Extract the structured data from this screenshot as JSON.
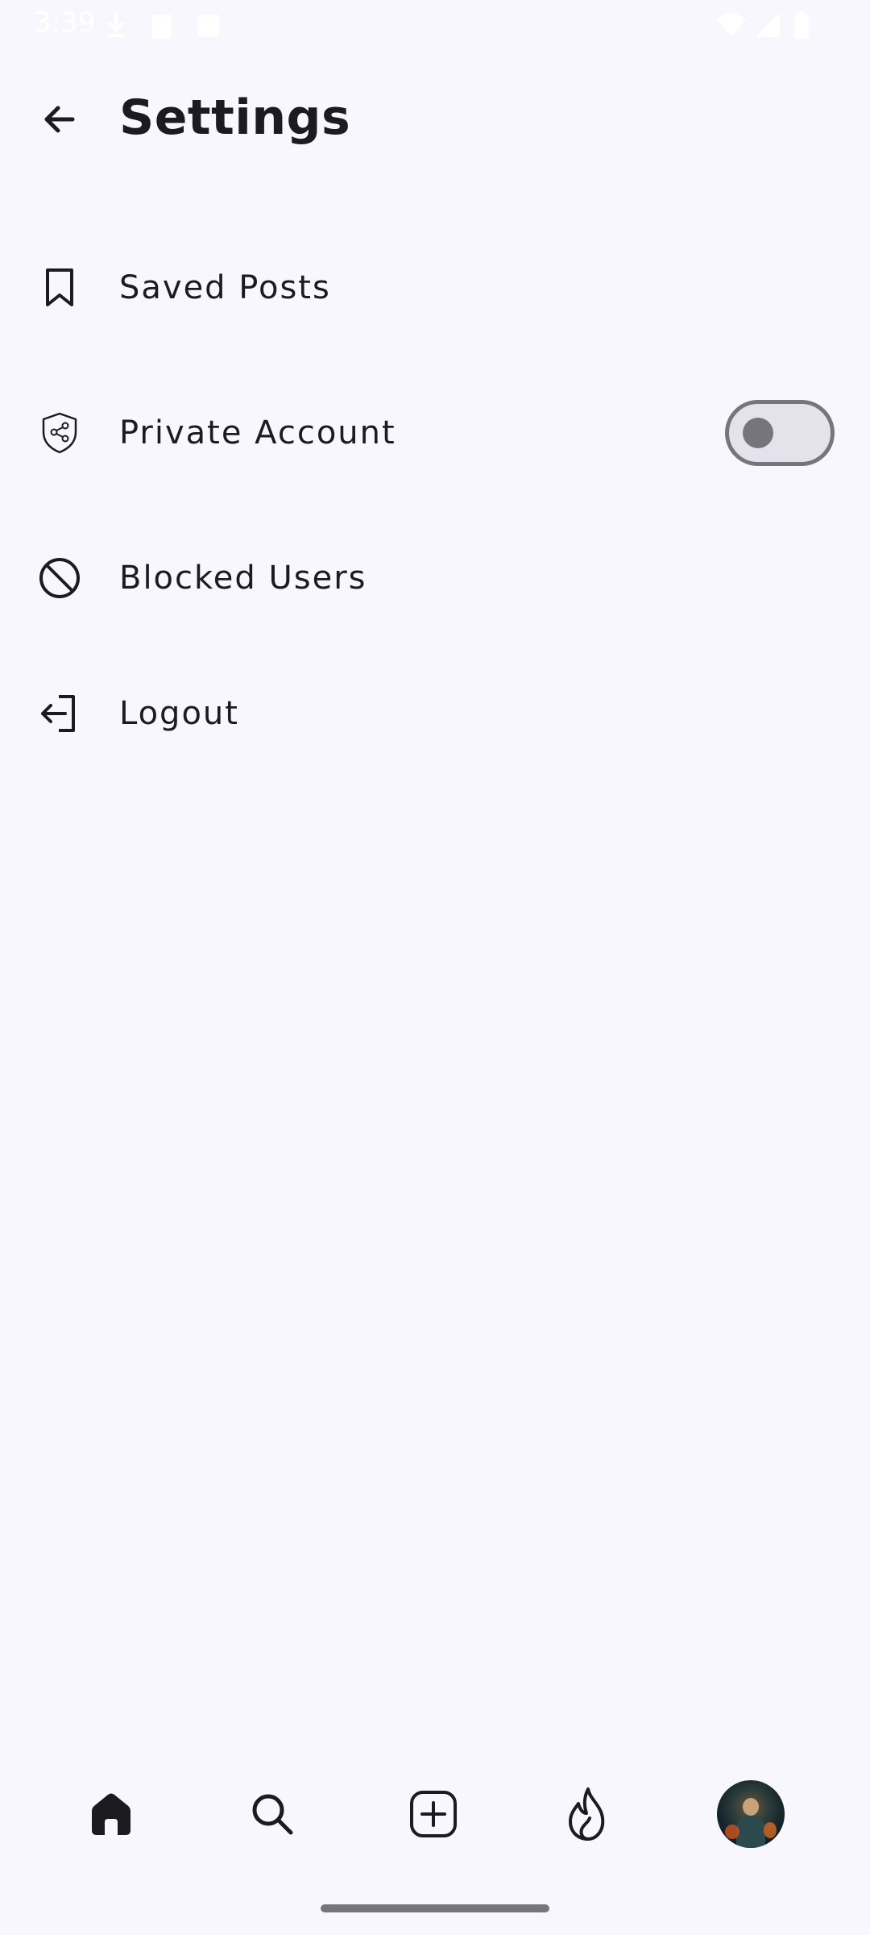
{
  "status_bar": {
    "time": "3:39",
    "icons": [
      "download-icon",
      "clipboard-icon",
      "a-icon",
      "wifi-icon",
      "signal-icon",
      "battery-icon"
    ]
  },
  "header": {
    "title": "Settings",
    "back_icon": "arrow-left-icon"
  },
  "settings": {
    "items": [
      {
        "label": "Saved Posts",
        "icon": "bookmark-icon"
      },
      {
        "label": "Private Account",
        "icon": "shield-share-icon",
        "toggle": {
          "on": false
        }
      },
      {
        "label": "Blocked Users",
        "icon": "block-icon"
      },
      {
        "label": "Logout",
        "icon": "logout-icon"
      }
    ]
  },
  "bottom_nav": {
    "items": [
      {
        "name": "home",
        "icon": "home-icon",
        "active": true
      },
      {
        "name": "search",
        "icon": "search-icon"
      },
      {
        "name": "create",
        "icon": "add-square-icon"
      },
      {
        "name": "trending",
        "icon": "flame-icon"
      },
      {
        "name": "profile",
        "icon": "avatar"
      }
    ]
  },
  "colors": {
    "background": "#f8f7fd",
    "text": "#1c1b20",
    "toggle_track": "#e4e2ea",
    "toggle_outline": "#76757c"
  }
}
